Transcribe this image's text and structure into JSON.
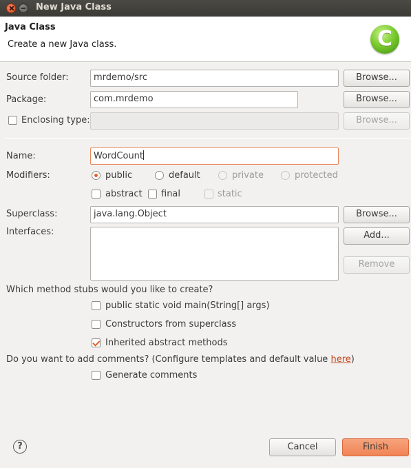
{
  "window": {
    "title": "New Java Class"
  },
  "banner": {
    "title": "Java Class",
    "description": "Create a new Java class."
  },
  "source_folder": {
    "label": "Source folder:",
    "value": "mrdemo/src",
    "browse_label": "Browse..."
  },
  "package": {
    "label": "Package:",
    "value": "com.mrdemo",
    "browse_label": "Browse..."
  },
  "enclosing_type": {
    "label": "Enclosing type:",
    "value": "",
    "browse_label": "Browse..."
  },
  "name": {
    "label": "Name:",
    "value": "WordCount"
  },
  "modifiers": {
    "label": "Modifiers:",
    "access": [
      "public",
      "default",
      "private",
      "protected"
    ],
    "selected": "public",
    "abstract_label": "abstract",
    "final_label": "final",
    "static_label": "static"
  },
  "superclass": {
    "label": "Superclass:",
    "value": "java.lang.Object",
    "browse_label": "Browse..."
  },
  "interfaces": {
    "label": "Interfaces:",
    "add_label": "Add...",
    "remove_label": "Remove"
  },
  "stubs": {
    "question": "Which method stubs would you like to create?",
    "main_label": "public static void main(String[] args)",
    "constructors_label": "Constructors from superclass",
    "inherited_label": "Inherited abstract methods",
    "inherited_checked": true
  },
  "comments": {
    "question_before": "Do you want to add comments? (Configure templates and default value ",
    "link": "here",
    "question_after": ")",
    "generate_label": "Generate comments"
  },
  "footer": {
    "help_symbol": "?",
    "cancel_label": "Cancel",
    "finish_label": "Finish"
  },
  "colors": {
    "accent": "#e0602a",
    "finish_button": "#f08456",
    "title_bar": "#3b3a36"
  }
}
